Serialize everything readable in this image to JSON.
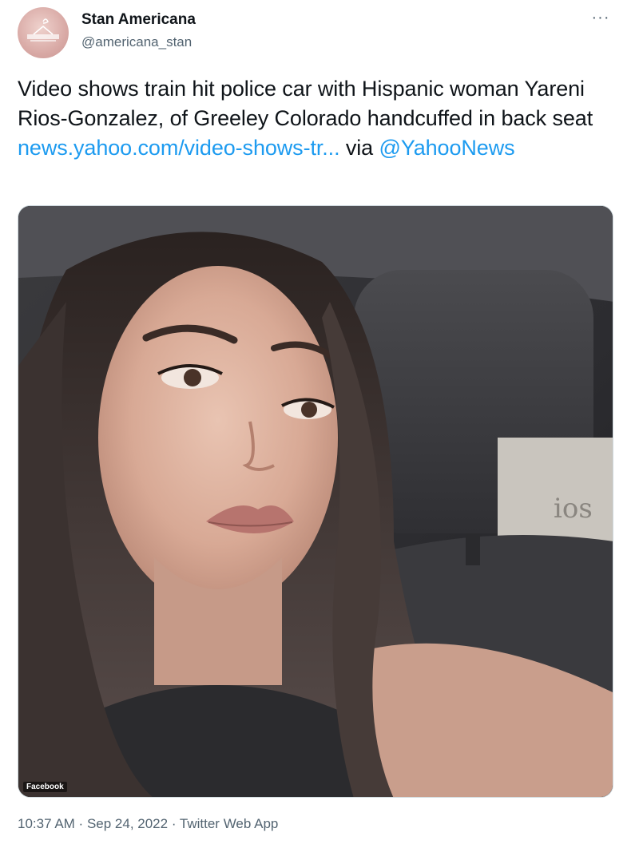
{
  "author": {
    "display_name": "Stan Americana",
    "handle": "@americana_stan",
    "avatar_icon": "avatar-logo-icon"
  },
  "more_label": "···",
  "tweet": {
    "text_part1": "Video shows train hit police car with Hispanic woman Yareni Rios-Gonzalez, of Greeley Colorado handcuffed in back seat ",
    "link_text": "news.yahoo.com/video-shows-tr...",
    "text_part2": " via ",
    "mention": "@YahooNews"
  },
  "media": {
    "watermark": "Facebook",
    "background_text": "ios"
  },
  "meta": {
    "time": "10:37 AM",
    "separator1": " · ",
    "date": "Sep 24, 2022",
    "separator2": " · ",
    "source": "Twitter Web App"
  },
  "colors": {
    "link": "#1d9bf0",
    "text": "#0f1419",
    "secondary": "#536471"
  }
}
